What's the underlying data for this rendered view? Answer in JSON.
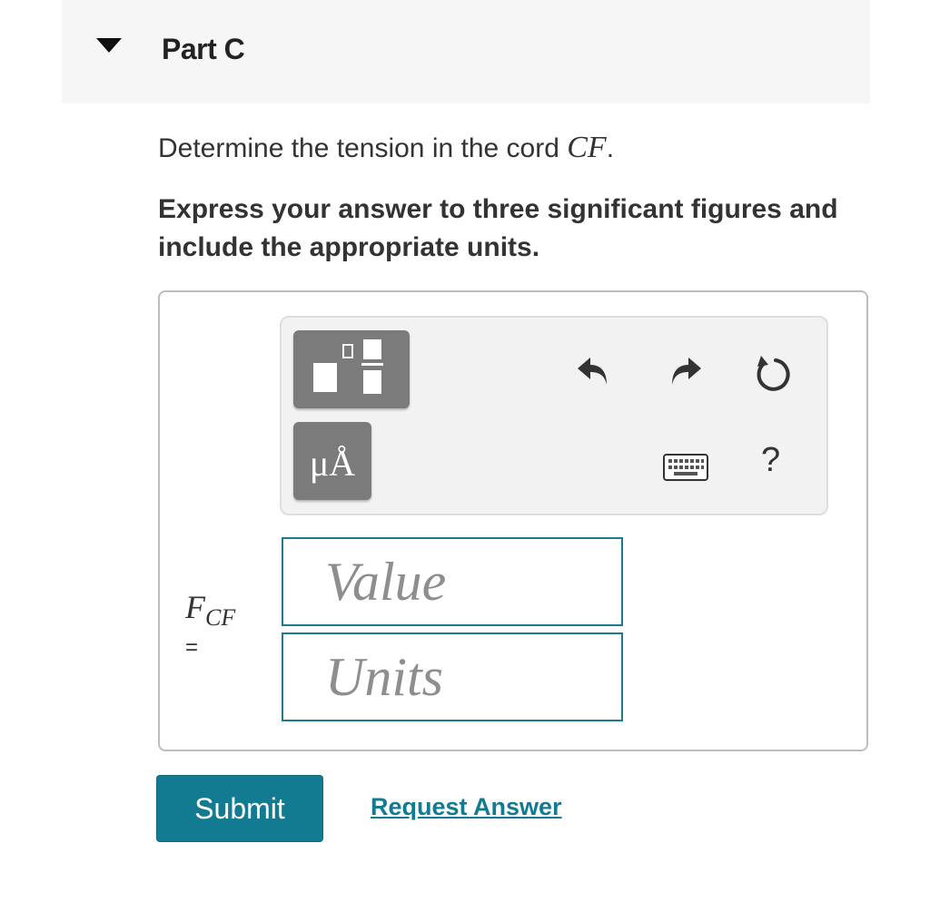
{
  "part": {
    "title": "Part C",
    "collapse_icon": "caret-down-icon"
  },
  "question": {
    "text_before": "Determine the tension in the cord ",
    "math": "CF",
    "text_after": "."
  },
  "instruction": "Express your answer to three significant figures and include the appropriate units.",
  "toolbar": {
    "templates_icon": "templates-icon",
    "units_label": "μÅ",
    "undo_icon": "undo-icon",
    "redo_icon": "redo-icon",
    "reset_icon": "reset-icon",
    "keyboard_icon": "keyboard-icon",
    "help_label": "?"
  },
  "answer": {
    "variable": "F",
    "variable_subscript": "CF",
    "equals": "=",
    "value_placeholder": "Value",
    "units_placeholder": "Units"
  },
  "actions": {
    "submit_label": "Submit",
    "request_label": "Request Answer"
  },
  "colors": {
    "accent": "#137b91",
    "field_border": "#1b7a8c",
    "button_gray": "#7b7b7b"
  }
}
